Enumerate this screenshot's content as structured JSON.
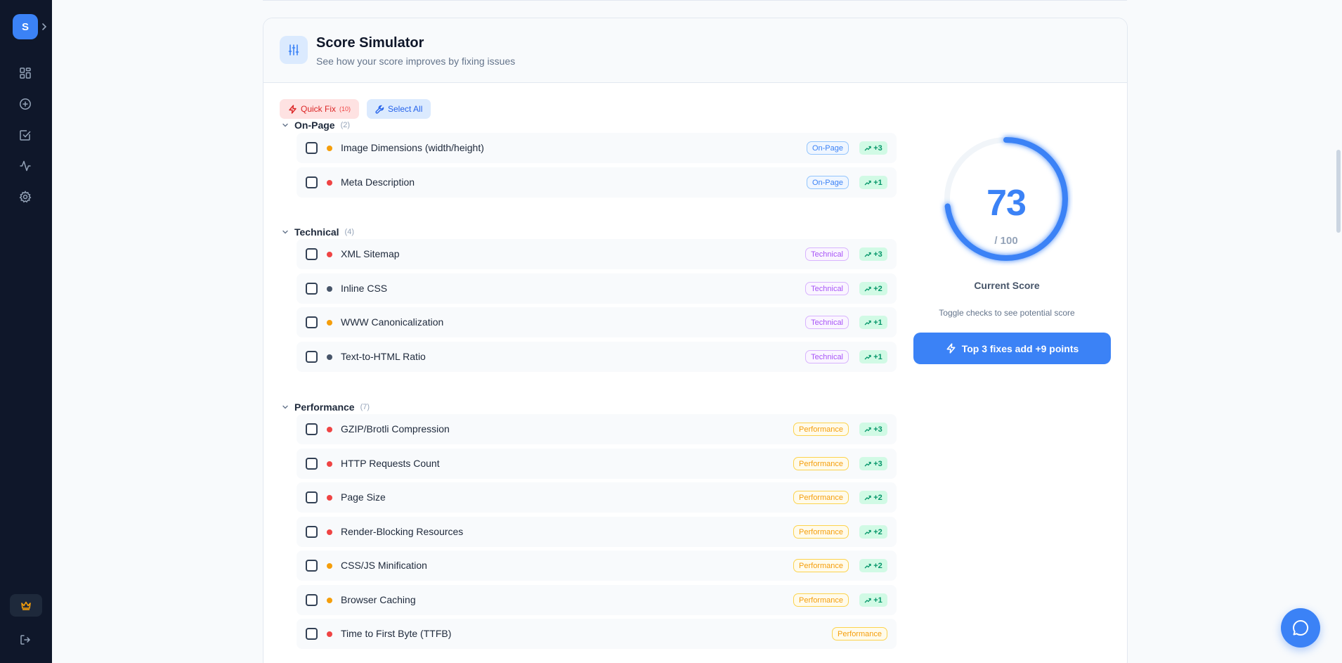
{
  "sidebar": {
    "logo_letter": "S",
    "nav": [
      {
        "icon": "dashboard-icon"
      },
      {
        "icon": "plus-circle-icon"
      },
      {
        "icon": "checklist-icon"
      },
      {
        "icon": "activity-icon"
      },
      {
        "icon": "gear-icon"
      }
    ],
    "crown_icon": "crown-icon",
    "logout_icon": "logout-icon"
  },
  "simulator": {
    "title": "Score Simulator",
    "subtitle": "See how your score improves by fixing issues",
    "quick_fix_label": "Quick Fix",
    "quick_fix_count": "(10)",
    "select_all_label": "Select All"
  },
  "groups": [
    {
      "name": "On-Page",
      "count": "(2)",
      "items": [
        {
          "label": "Image Dimensions (width/height)",
          "tag": "On-Page",
          "points": "+3",
          "severity": "#f59e0b"
        },
        {
          "label": "Meta Description",
          "tag": "On-Page",
          "points": "+1",
          "severity": "#ef4444"
        }
      ]
    },
    {
      "name": "Technical",
      "count": "(4)",
      "items": [
        {
          "label": "XML Sitemap",
          "tag": "Technical",
          "points": "+3",
          "severity": "#ef4444"
        },
        {
          "label": "Inline CSS",
          "tag": "Technical",
          "points": "+2",
          "severity": "#475569"
        },
        {
          "label": "WWW Canonicalization",
          "tag": "Technical",
          "points": "+1",
          "severity": "#f59e0b"
        },
        {
          "label": "Text-to-HTML Ratio",
          "tag": "Technical",
          "points": "+1",
          "severity": "#475569"
        }
      ]
    },
    {
      "name": "Performance",
      "count": "(7)",
      "items": [
        {
          "label": "GZIP/Brotli Compression",
          "tag": "Performance",
          "points": "+3",
          "severity": "#ef4444"
        },
        {
          "label": "HTTP Requests Count",
          "tag": "Performance",
          "points": "+3",
          "severity": "#ef4444"
        },
        {
          "label": "Page Size",
          "tag": "Performance",
          "points": "+2",
          "severity": "#ef4444"
        },
        {
          "label": "Render-Blocking Resources",
          "tag": "Performance",
          "points": "+2",
          "severity": "#ef4444"
        },
        {
          "label": "CSS/JS Minification",
          "tag": "Performance",
          "points": "+2",
          "severity": "#f59e0b"
        },
        {
          "label": "Browser Caching",
          "tag": "Performance",
          "points": "+1",
          "severity": "#f59e0b"
        },
        {
          "label": "Time to First Byte (TTFB)",
          "tag": "Performance",
          "points": "",
          "severity": "#ef4444"
        }
      ]
    }
  ],
  "score": {
    "value": "73",
    "max": "/ 100",
    "progress": 0.73,
    "label": "Current Score",
    "hint": "Toggle checks to see potential score",
    "top_fix_label": "Top 3 fixes add +9 points"
  },
  "colors": {
    "accent": "#3b82f6",
    "sidebar_bg": "#0f172a",
    "critical": "#ef4444",
    "warning": "#f59e0b",
    "info": "#475569",
    "success": "#059669"
  }
}
